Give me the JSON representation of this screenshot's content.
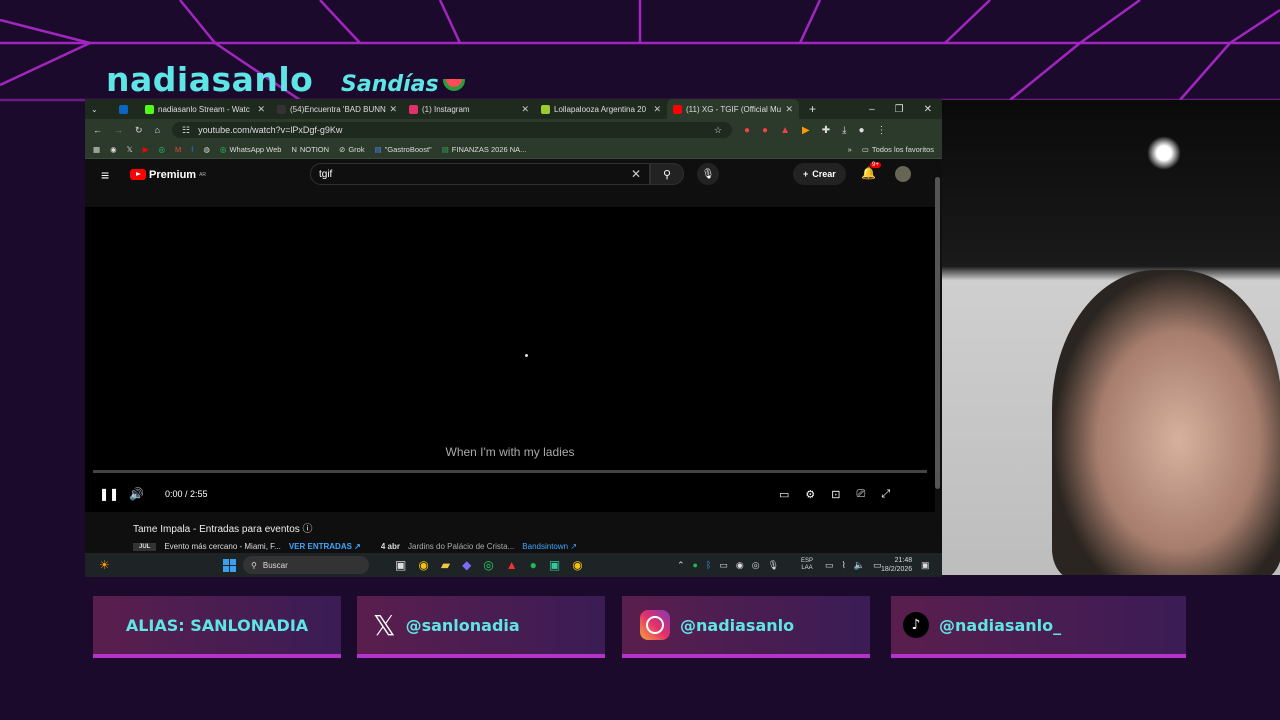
{
  "overlay": {
    "channel_name": "nadiasanlo",
    "subtitle": "Sandías"
  },
  "tabs": [
    {
      "label": "in",
      "favcolor": "#0a66c2"
    },
    {
      "label": "nadiasanlo Stream - Watc",
      "favcolor": "#53fc18"
    },
    {
      "label": "(54)Encuentra 'BAD BUNN",
      "favcolor": "#000000"
    },
    {
      "label": "(1) Instagram",
      "favcolor": "#e1306c"
    },
    {
      "label": "Lollapalooza Argentina 20",
      "favcolor": "#9acd32"
    },
    {
      "label": "(11) XG - TGIF (Official Mu",
      "favcolor": "#ff0000"
    }
  ],
  "window": {
    "new_tab": "+",
    "minimize": "–",
    "maximize": "❐",
    "close": "✕"
  },
  "address": {
    "url": "youtube.com/watch?v=lPxDgf-g9Kw"
  },
  "bookmarks": [
    "WhatsApp Web",
    "NOTION",
    "Grok",
    "\"GastroBoost\"",
    "FINANZAS 2026 NA...",
    "Todos los favoritos"
  ],
  "youtube": {
    "logo": "Premium",
    "region": "AR",
    "search_value": "tgif",
    "create_label": "Crear",
    "notif_count": "9+"
  },
  "player": {
    "caption": "When I'm with my ladies",
    "time": "0:00 / 2:55",
    "progress": 0
  },
  "below": {
    "title": "Tame Impala - Entradas para eventos",
    "month": "JUL",
    "event_text": "Evento más cercano - Miami, F...",
    "cta": "VER ENTRADAS ↗",
    "date": "4 abr",
    "venue": "Jardins do Palácio de Crista...",
    "source": "Bandsintown ↗"
  },
  "taskbar": {
    "search_placeholder": "Buscar",
    "lang_top": "ESP",
    "lang_bottom": "LAA",
    "time": "21:48",
    "date": "18/2/2026"
  },
  "social": [
    {
      "label": "ALIAS: SANLONADIA",
      "icon": ""
    },
    {
      "label": "@sanlonadia",
      "icon": "x-icon"
    },
    {
      "label": "@nadiasanlo",
      "icon": "instagram-icon"
    },
    {
      "label": "@nadiasanlo_",
      "icon": "tiktok-icon"
    }
  ]
}
